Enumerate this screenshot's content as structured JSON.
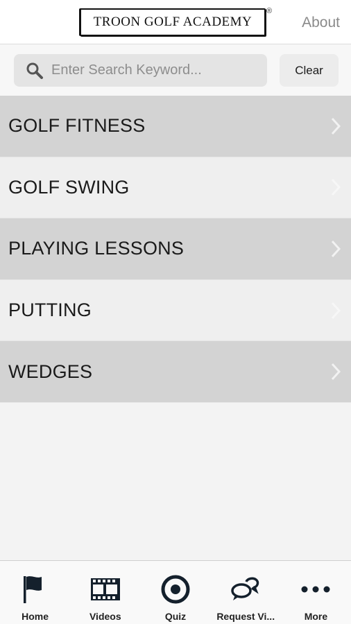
{
  "header": {
    "logo_text": "TROON GOLF ACADEMY",
    "logo_mark": "®",
    "about_label": "About"
  },
  "search": {
    "placeholder": "Enter Search Keyword...",
    "value": "",
    "clear_label": "Clear"
  },
  "categories": [
    {
      "label": "GOLF FITNESS"
    },
    {
      "label": "GOLF SWING"
    },
    {
      "label": "PLAYING LESSONS"
    },
    {
      "label": "PUTTING"
    },
    {
      "label": "WEDGES"
    }
  ],
  "tabs": [
    {
      "label": "Home",
      "icon": "flag-icon"
    },
    {
      "label": "Videos",
      "icon": "film-icon"
    },
    {
      "label": "Quiz",
      "icon": "target-icon"
    },
    {
      "label": "Request Vi...",
      "icon": "chat-bubbles-icon"
    },
    {
      "label": "More",
      "icon": "more-dots-icon"
    }
  ],
  "colors": {
    "row_dark": "#d3d3d3",
    "row_light": "#efefef",
    "icon_dark": "#14202c"
  }
}
